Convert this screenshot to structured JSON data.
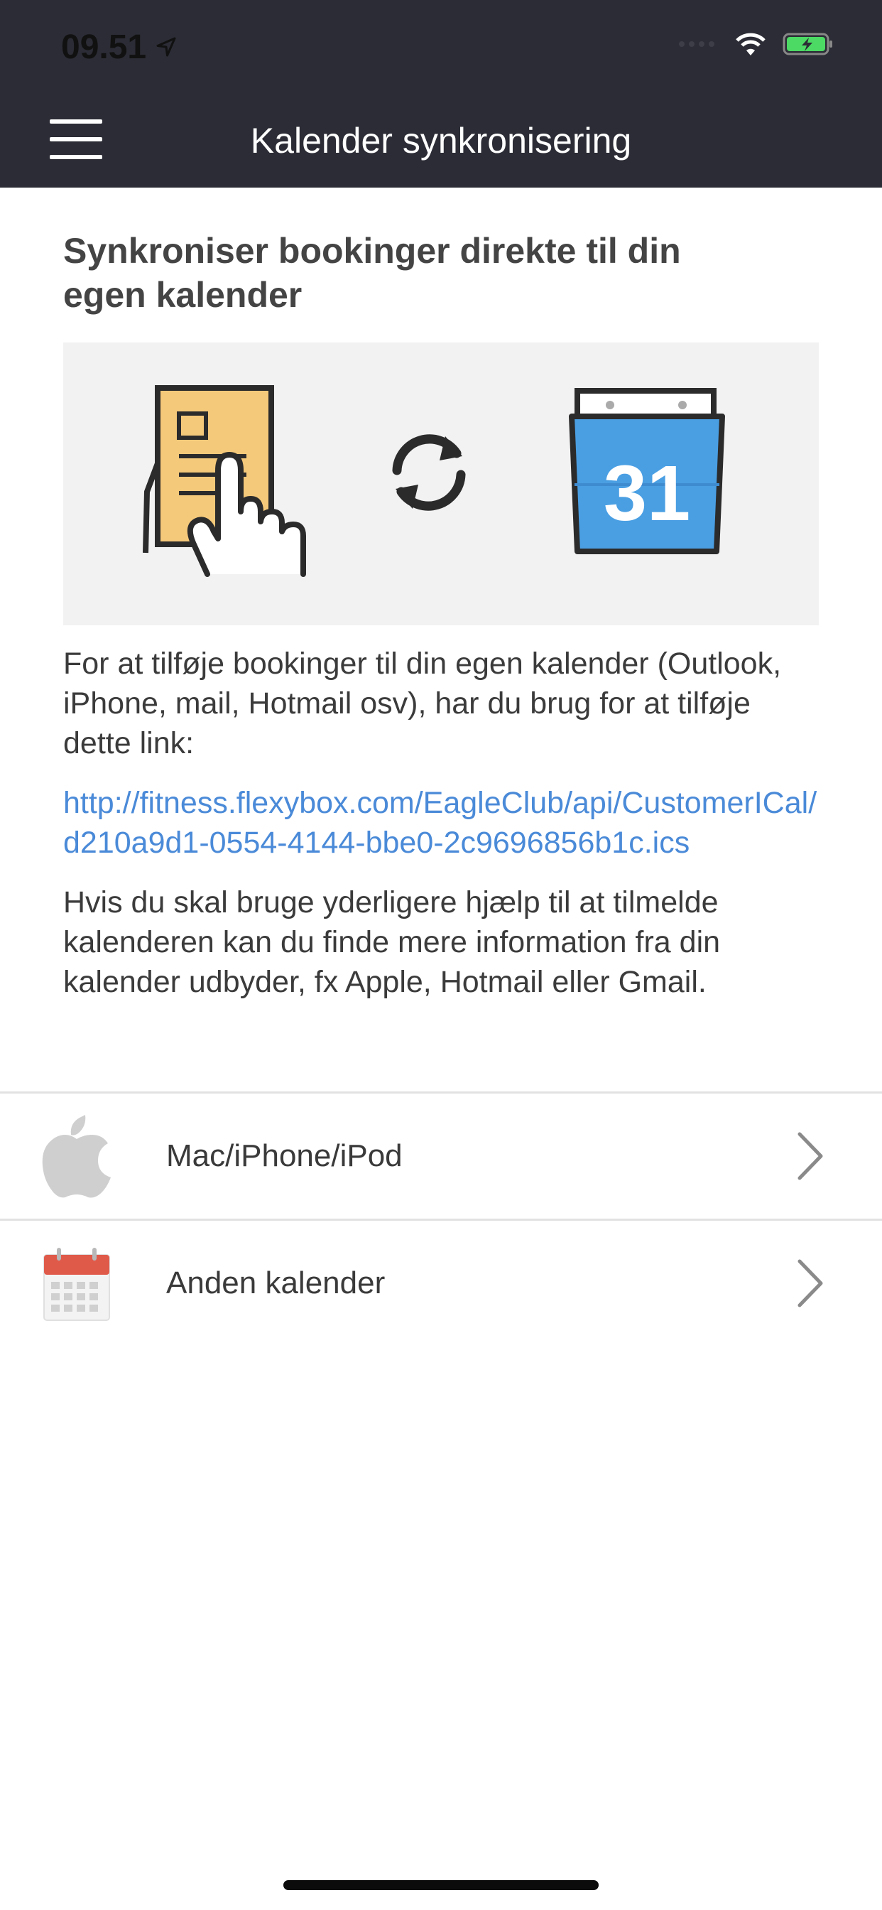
{
  "status": {
    "time": "09.51"
  },
  "nav": {
    "title": "Kalender synkronisering"
  },
  "content": {
    "heading": "Synkroniser bookinger direkte til din egen kalender",
    "illustration_date": "31",
    "paragraph1": "For at tilføje bookinger til din egen kalender (Outlook, iPhone, mail, Hotmail osv), har du brug for at tilføje dette link:",
    "link": "http://fitness.flexybox.com/EagleClub/api/CustomerICal/d210a9d1-0554-4144-bbe0-2c9696856b1c.ics",
    "paragraph2": "Hvis du skal bruge yderligere hjælp til at tilmelde kalenderen kan du finde mere information fra din kalender udbyder, fx Apple, Hotmail eller Gmail."
  },
  "options": [
    {
      "label": "Mac/iPhone/iPod",
      "icon": "apple-icon"
    },
    {
      "label": "Anden kalender",
      "icon": "calendar-icon"
    }
  ],
  "colors": {
    "navbar": "#2b2c35",
    "link": "#4a8ad8",
    "illustration_bg": "#f2f2f2",
    "calendar_blue": "#4a9fe3",
    "doc_yellow": "#f5c97a"
  }
}
